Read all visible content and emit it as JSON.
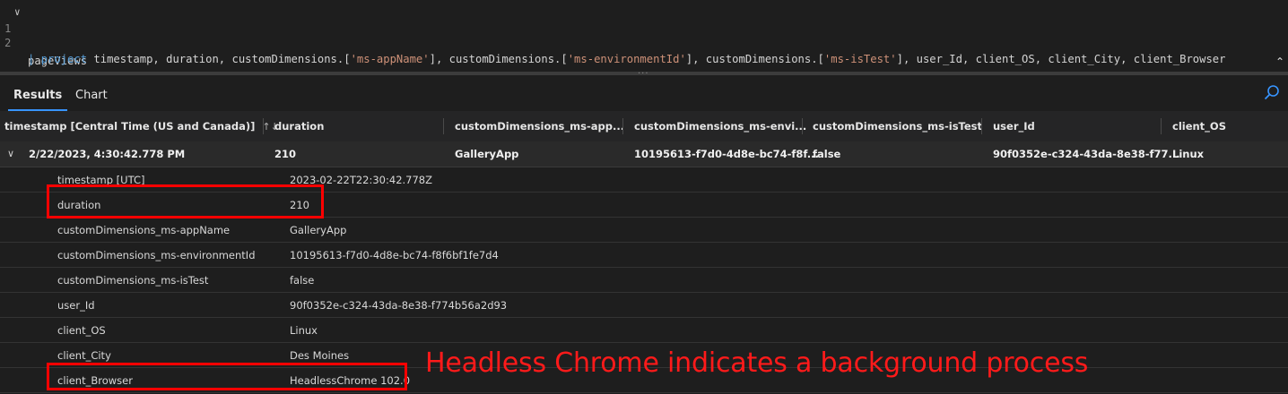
{
  "editor": {
    "line1_number": "1",
    "line2_number": "2",
    "line1_text": "pageViews",
    "line2": {
      "pipe": "|",
      "keyword": "project",
      "p1": " timestamp, duration, customDimensions.[",
      "s1": "'ms-appName'",
      "p2": "], customDimensions.[",
      "s2": "'ms-environmentId'",
      "p3": "], customDimensions.[",
      "s3": "'ms-isTest'",
      "p4": "], user_Id, client_OS, client_City, client_Browser"
    },
    "fold_icon": "chevron-down-icon",
    "collapse_icon": "double-chevron-up-icon"
  },
  "tabs": {
    "results": "Results",
    "chart": "Chart",
    "search_icon": "search-icon"
  },
  "grid": {
    "columns": [
      "timestamp [Central Time (US and Canada)]",
      "duration",
      "customDimensions_ms-app...",
      "customDimensions_ms-envi...",
      "customDimensions_ms-isTest",
      "user_Id",
      "client_OS"
    ],
    "sort_icon": "↑↓",
    "row": {
      "timestamp": "2/22/2023, 4:30:42.778 PM",
      "duration": "210",
      "app": "GalleryApp",
      "env": "10195613-f7d0-4d8e-bc74-f8f...",
      "isTest": "false",
      "user_Id": "90f0352e-c324-43da-8e38-f77...",
      "client_OS": "Linux"
    },
    "details": [
      {
        "key": "timestamp [UTC]",
        "value": "2023-02-22T22:30:42.778Z"
      },
      {
        "key": "duration",
        "value": "210"
      },
      {
        "key": "customDimensions_ms-appName",
        "value": "GalleryApp"
      },
      {
        "key": "customDimensions_ms-environmentId",
        "value": "10195613-f7d0-4d8e-bc74-f8f6bf1fe7d4"
      },
      {
        "key": "customDimensions_ms-isTest",
        "value": "false"
      },
      {
        "key": "user_Id",
        "value": "90f0352e-c324-43da-8e38-f774b56a2d93"
      },
      {
        "key": "client_OS",
        "value": "Linux"
      },
      {
        "key": "client_City",
        "value": "Des Moines"
      },
      {
        "key": "client_Browser",
        "value": "HeadlessChrome 102.0"
      }
    ]
  },
  "annotation": {
    "text": "Headless Chrome indicates a background process",
    "color": "#ff0000"
  }
}
